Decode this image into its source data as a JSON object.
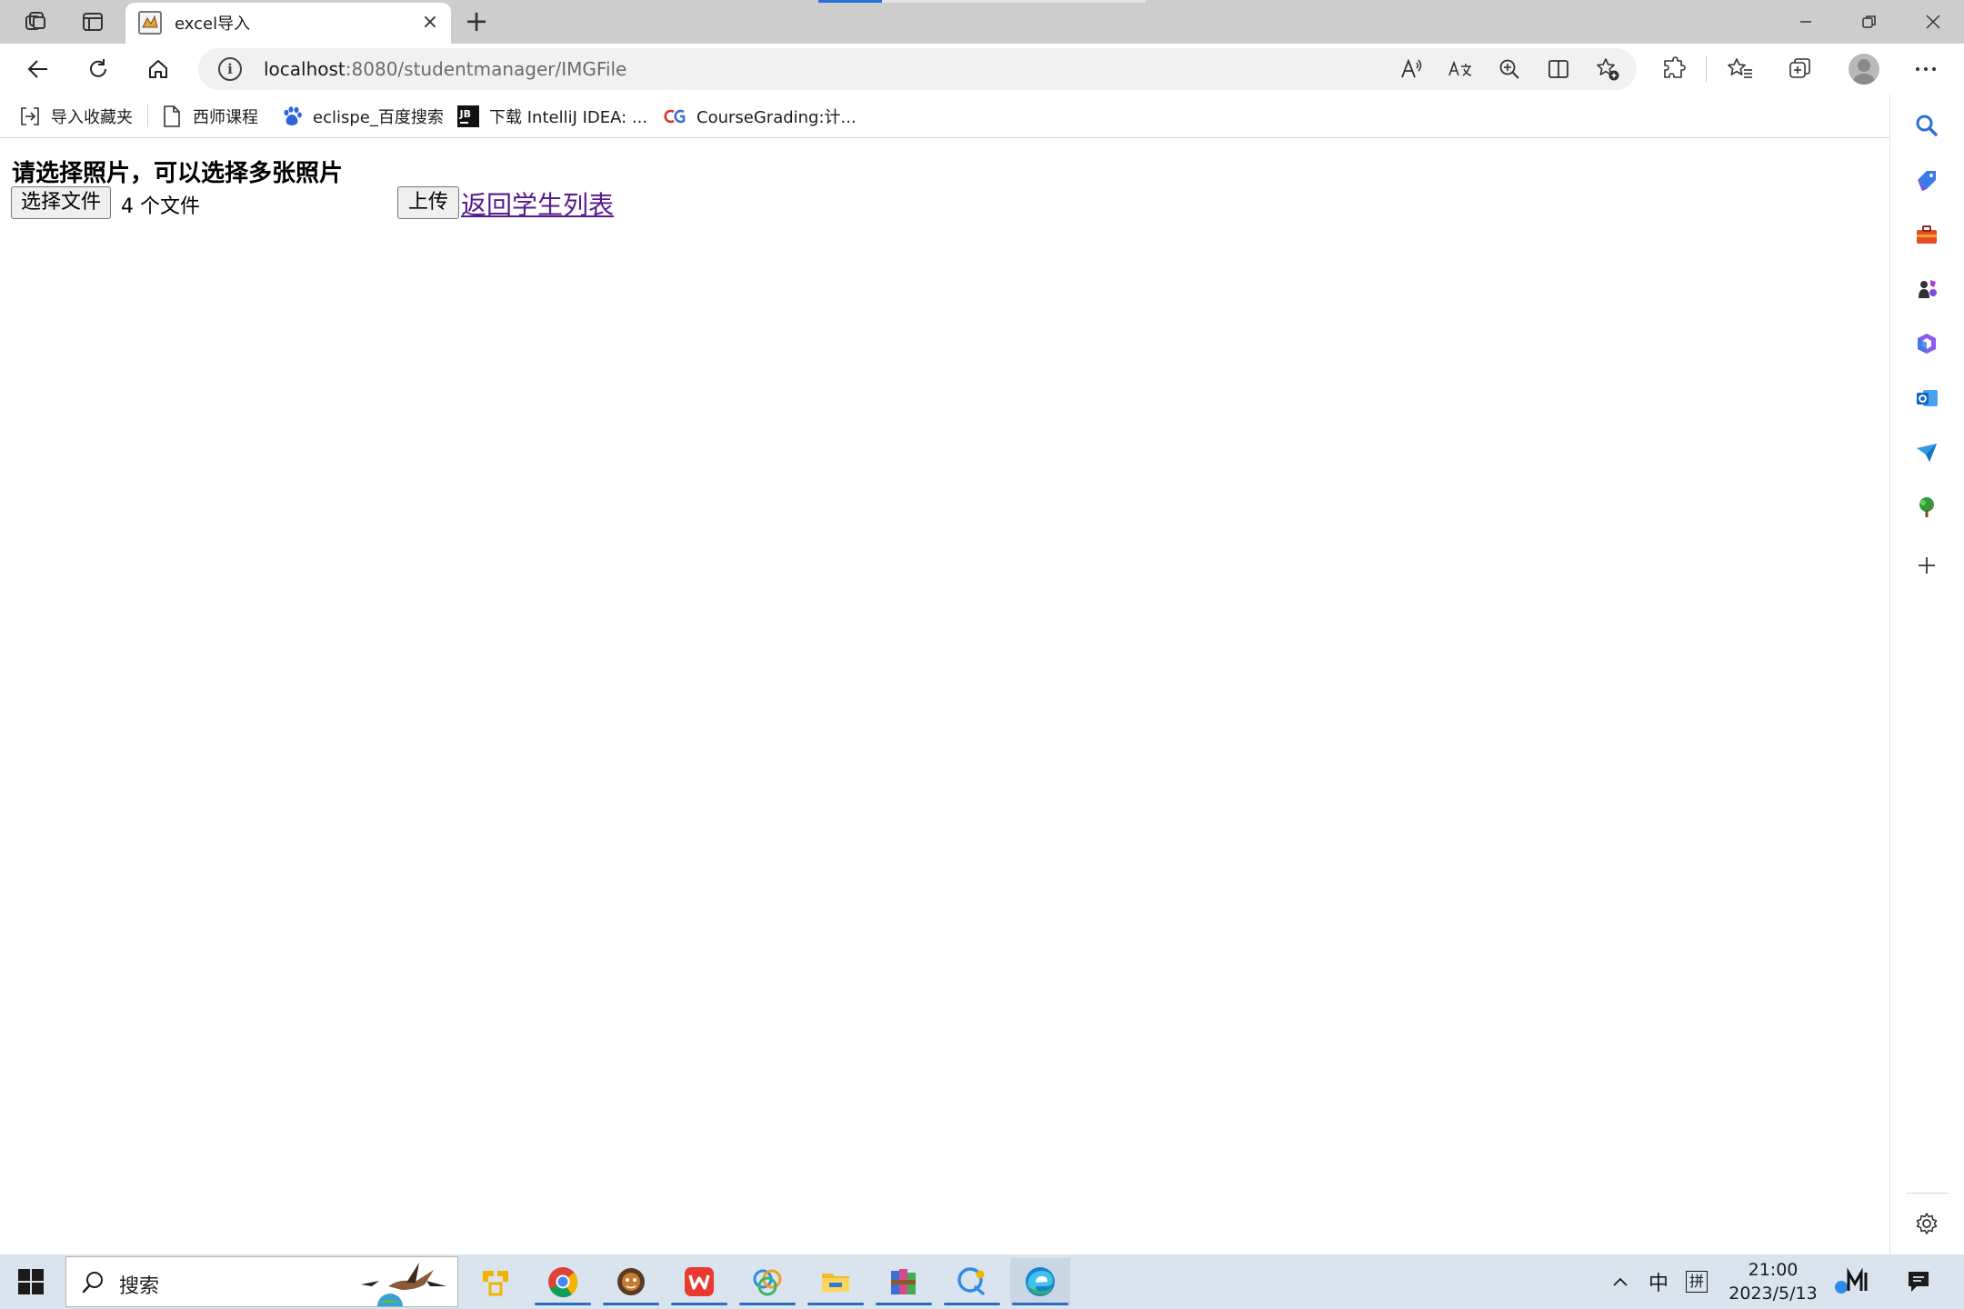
{
  "browser": {
    "tab": {
      "title": "excel导入",
      "close_glyph": "×",
      "favicon": "tomcat-favicon-icon"
    },
    "new_tab_glyph": "+",
    "window_controls": {
      "minimize_glyph": "–",
      "restore_glyph": "❐",
      "close_glyph": "✕"
    },
    "address": {
      "host": "localhost",
      "rest": ":8080/studentmanager/IMGFile",
      "info_glyph": "i"
    }
  },
  "bookmarks": [
    {
      "label": "导入收藏夹",
      "icon": "import-favorites-icon"
    },
    {
      "label": "西师课程",
      "icon": "page-icon"
    },
    {
      "label": "eclispe_百度搜索",
      "icon": "baidu-paw-icon"
    },
    {
      "label": "下载 IntelliJ IDEA: ...",
      "icon": "jetbrains-icon"
    },
    {
      "label": "CourseGrading:计...",
      "icon": "coursegrading-icon"
    }
  ],
  "page": {
    "heading": "请选择照片，可以选择多张照片",
    "file_button": "选择文件",
    "file_status": "4 个文件",
    "upload_button": "上传",
    "back_link": "返回学生列表"
  },
  "taskbar": {
    "search_placeholder": "搜索",
    "tray": {
      "overflow_glyph": "^",
      "ime_lang": "中",
      "ime_mode": "拼"
    },
    "clock": {
      "time": "21:00",
      "date": "2023/5/13"
    }
  },
  "colors": {
    "tab_strip": "#cdcdcd",
    "link_visited": "#551a8b",
    "taskbar": "#dae4ee",
    "accent": "#2d6cbf"
  }
}
